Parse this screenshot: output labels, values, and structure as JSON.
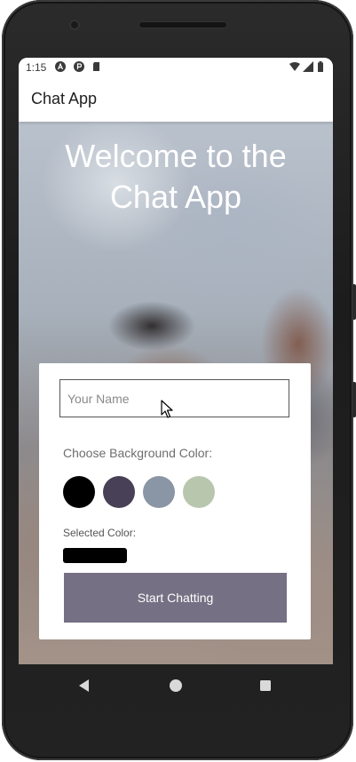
{
  "status_bar": {
    "time": "1:15",
    "icons": [
      "a-logo-icon",
      "p-logo-icon",
      "sd-card-icon",
      "wifi-icon",
      "signal-icon",
      "battery-icon"
    ]
  },
  "app_bar": {
    "title": "Chat App"
  },
  "welcome": {
    "line1": "Welcome to the",
    "line2": "Chat App"
  },
  "form": {
    "name_placeholder": "Your Name",
    "name_value": "",
    "choose_label": "Choose Background Color:",
    "colors": [
      {
        "name": "black",
        "hex": "#000000"
      },
      {
        "name": "dark-purple",
        "hex": "#474056"
      },
      {
        "name": "slate-blue",
        "hex": "#8A95A5"
      },
      {
        "name": "sage-green",
        "hex": "#B9C6AE"
      }
    ],
    "selected_label": "Selected Color:",
    "selected_color": "#000000",
    "start_button": "Start Chatting",
    "button_color": "#757083"
  },
  "navigation": {
    "buttons": [
      "back-icon",
      "home-icon",
      "recents-icon"
    ]
  }
}
